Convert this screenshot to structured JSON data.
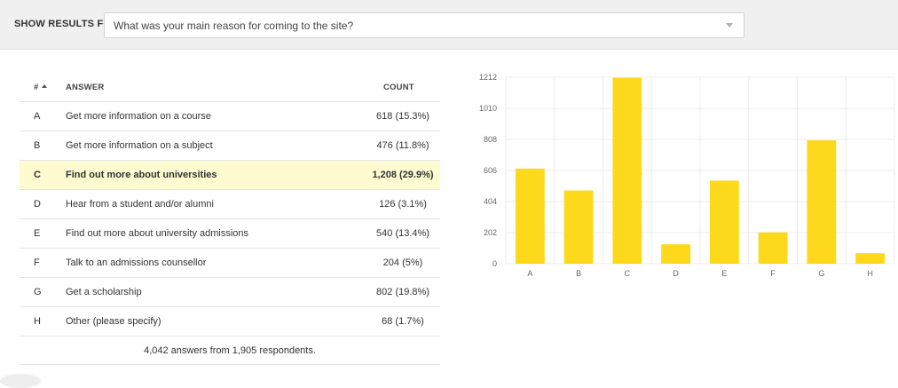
{
  "filter": {
    "label": "SHOW RESULTS FOR:",
    "selected": "What was your main reason for coming to the site?"
  },
  "table": {
    "headers": {
      "number": "#",
      "answer": "ANSWER",
      "count": "COUNT"
    },
    "rows": [
      {
        "letter": "A",
        "answer": "Get more information on a course",
        "count": "618 (15.3%)",
        "highlighted": false
      },
      {
        "letter": "B",
        "answer": "Get more information on a subject",
        "count": "476 (11.8%)",
        "highlighted": false
      },
      {
        "letter": "C",
        "answer": "Find out more about universities",
        "count": "1,208 (29.9%)",
        "highlighted": true
      },
      {
        "letter": "D",
        "answer": "Hear from a student and/or alumni",
        "count": "126 (3.1%)",
        "highlighted": false
      },
      {
        "letter": "E",
        "answer": "Find out more about university admissions",
        "count": "540 (13.4%)",
        "highlighted": false
      },
      {
        "letter": "F",
        "answer": "Talk to an admissions counsellor",
        "count": "204 (5%)",
        "highlighted": false
      },
      {
        "letter": "G",
        "answer": "Get a scholarship",
        "count": "802 (19.8%)",
        "highlighted": false
      },
      {
        "letter": "H",
        "answer": "Other (please specify)",
        "count": "68 (1.7%)",
        "highlighted": false
      }
    ],
    "summary": "4,042 answers from 1,905 respondents."
  },
  "colors": {
    "bar": "#fcd91a",
    "highlight": "#fdfbcf",
    "grid": "#ececec"
  },
  "chart_data": {
    "type": "bar",
    "categories": [
      "A",
      "B",
      "C",
      "D",
      "E",
      "F",
      "G",
      "H"
    ],
    "values": [
      618,
      476,
      1208,
      126,
      540,
      204,
      802,
      68
    ],
    "yticks": [
      0,
      202,
      404,
      606,
      808,
      1010,
      1212
    ],
    "ylim": [
      0,
      1212
    ],
    "title": "",
    "xlabel": "",
    "ylabel": "",
    "grid": true,
    "legend": false
  }
}
